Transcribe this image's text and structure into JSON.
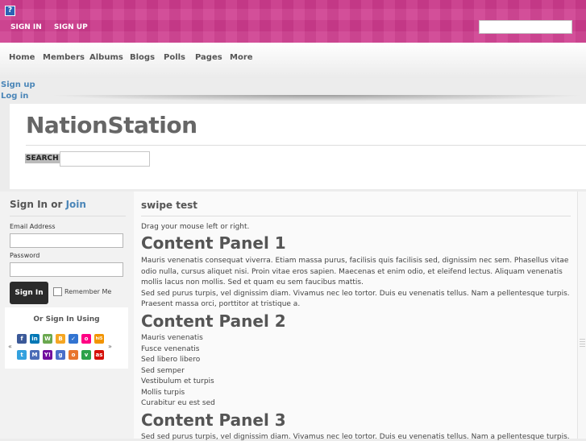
{
  "topbar": {
    "help_icon_glyph": "?",
    "sign_in": "SIGN IN",
    "sign_up": "SIGN UP",
    "search_placeholder": ""
  },
  "nav": [
    "Home",
    "Members",
    "Albums",
    "Blogs",
    "Polls",
    "Pages",
    "More"
  ],
  "account_links": {
    "sign_up": "Sign up",
    "log_in": "Log in"
  },
  "header": {
    "site_title": "NationStation",
    "search_label": "SEARCH",
    "search_value": ""
  },
  "sidebar": {
    "title_prefix": "Sign In or ",
    "title_join": "Join",
    "email_label": "Email Address",
    "password_label": "Password",
    "signin_button": "Sign In",
    "remember_label": "Remember Me",
    "social_title": "Or Sign In Using",
    "arrow_left": "«",
    "arrow_right": "»",
    "social_icons": [
      {
        "name": "facebook-icon",
        "glyph": "f",
        "color": "#3b5998"
      },
      {
        "name": "linkedin-icon",
        "glyph": "in",
        "color": "#0077b5"
      },
      {
        "name": "windows-live-icon",
        "glyph": "W",
        "color": "#6aa84f"
      },
      {
        "name": "blogger-icon",
        "glyph": "B",
        "color": "#f5a623"
      },
      {
        "name": "delicious-icon",
        "glyph": "✓",
        "color": "#3274d1"
      },
      {
        "name": "flickr-icon",
        "glyph": "o",
        "color": "#ff0084"
      },
      {
        "name": "hi5-icon",
        "glyph": "hi5",
        "color": "#f29400"
      },
      {
        "name": "twitter-icon",
        "glyph": "t",
        "color": "#33a1de"
      },
      {
        "name": "myspace-icon",
        "glyph": "M",
        "color": "#4b6cb7"
      },
      {
        "name": "yahoo-icon",
        "glyph": "Y!",
        "color": "#720e9e"
      },
      {
        "name": "google-icon",
        "glyph": "g",
        "color": "#4a6fc9"
      },
      {
        "name": "orkut-icon",
        "glyph": "o",
        "color": "#e8742d"
      },
      {
        "name": "vimeo-icon",
        "glyph": "v",
        "color": "#2ca24a"
      },
      {
        "name": "lastfm-icon",
        "glyph": "as",
        "color": "#d51007"
      }
    ]
  },
  "content": {
    "title": "swipe test",
    "intro": "Drag your mouse left or right.",
    "panel1_heading": "Content Panel 1",
    "panel1_lines": [
      "Mauris venenatis consequat viverra. Etiam massa purus, facilisis quis facilisis sed, dignissim nec sem. Phasellus vitae",
      "odio nulla, cursus aliquet nisi. Proin vitae eros sapien. Maecenas et enim odio, et eleifend lectus. Aliquam venenatis",
      "mollis lacus non mollis. Sed et quam eu sem faucibus mattis.",
      "Sed sed purus turpis, vel dignissim diam. Vivamus nec leo tortor. Duis eu venenatis tellus. Nam a pellentesque turpis.",
      "Praesent massa orci, porttitor at tristique a."
    ],
    "panel2_heading": "Content Panel 2",
    "panel2_lines": [
      "Mauris venenatis",
      "Fusce venenatis",
      "Sed libero libero",
      "Sed semper",
      "Vestibulum et turpis",
      "Mollis turpis",
      "Curabitur eu est sed"
    ],
    "panel3_heading": "Content Panel 3",
    "panel3_line": "Sed sed purus turpis, vel dignissim diam. Vivamus nec leo tortor. Duis eu venenatis tellus. Nam a pellentesque turpis."
  }
}
